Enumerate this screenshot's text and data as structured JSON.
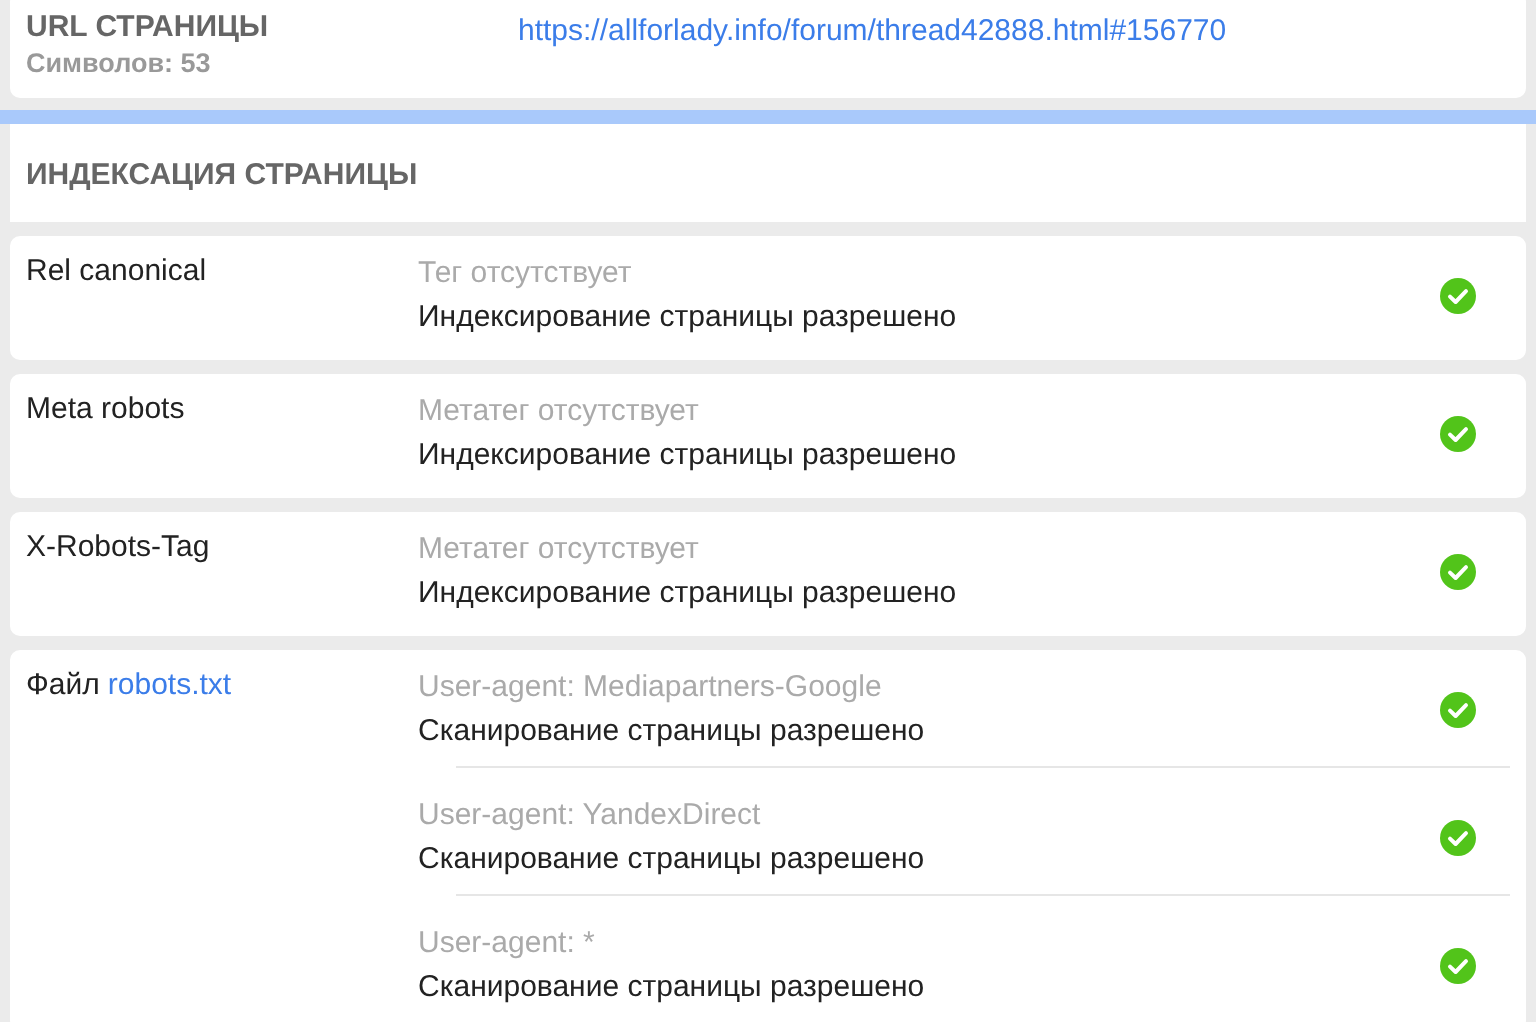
{
  "url_card": {
    "title": "URL СТРАНИЦЫ",
    "count": "Символов: 53",
    "url": "https://allforlady.info/forum/thread42888.html#156770"
  },
  "section": {
    "title": "ИНДЕКСАЦИЯ СТРАНИЦЫ"
  },
  "rows": [
    {
      "label": "Rel canonical",
      "checks": [
        {
          "note": "Тег отсутствует",
          "result": "Индексирование страницы разрешено",
          "passed": true
        }
      ]
    },
    {
      "label": "Meta robots",
      "checks": [
        {
          "note": "Метатег отсутствует",
          "result": "Индексирование страницы разрешено",
          "passed": true
        }
      ]
    },
    {
      "label": "X-Robots-Tag",
      "checks": [
        {
          "note": "Метатег отсутствует",
          "result": "Индексирование страницы разрешено",
          "passed": true
        }
      ]
    },
    {
      "label": "Файл",
      "link": "robots.txt",
      "checks": [
        {
          "note": "User-agent: Mediapartners-Google",
          "result": "Сканирование страницы разрешено",
          "passed": true
        },
        {
          "note": "User-agent: YandexDirect",
          "result": "Сканирование страницы разрешено",
          "passed": true
        },
        {
          "note": "User-agent: *",
          "result": "Сканирование страницы разрешено",
          "passed": true
        }
      ]
    }
  ]
}
